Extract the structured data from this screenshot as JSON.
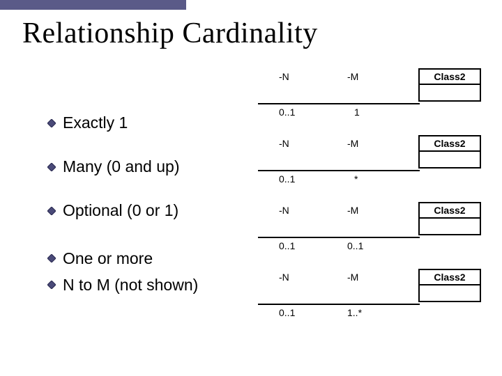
{
  "title": "Relationship Cardinality",
  "bullets": [
    "Exactly 1",
    "Many (0 and up)",
    "Optional (0 or 1)",
    "One or more",
    "N to M (not shown)"
  ],
  "diagrams": [
    {
      "className": "Class2",
      "topLeft": "-N",
      "topRight": "-M",
      "botLeft": "0..1",
      "botRight": "1"
    },
    {
      "className": "Class2",
      "topLeft": "-N",
      "topRight": "-M",
      "botLeft": "0..1",
      "botRight": "*"
    },
    {
      "className": "Class2",
      "topLeft": "-N",
      "topRight": "-M",
      "botLeft": "0..1",
      "botRight": "0..1"
    },
    {
      "className": "Class2",
      "topLeft": "-N",
      "topRight": "-M",
      "botLeft": "0..1",
      "botRight": "1..*"
    }
  ]
}
